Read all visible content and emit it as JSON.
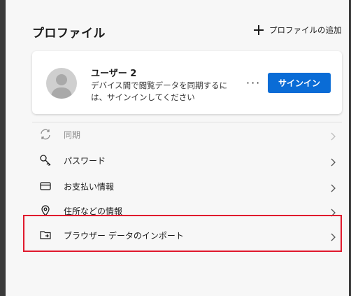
{
  "page": {
    "title": "プロファイル",
    "add_profile_label": "プロファイルの追加"
  },
  "profile_card": {
    "user_name": "ユーザー 2",
    "description": "デバイス間で閲覧データを同期するには、サインインしてください",
    "more_label": "···",
    "signin_label": "サインイン"
  },
  "menu": [
    {
      "label": "同期",
      "icon": "sync-icon",
      "disabled": true
    },
    {
      "label": "パスワード",
      "icon": "key-icon",
      "disabled": false
    },
    {
      "label": "お支払い情報",
      "icon": "credit-card-icon",
      "disabled": false
    },
    {
      "label": "住所などの情報",
      "icon": "location-pin-icon",
      "disabled": false
    },
    {
      "label": "ブラウザー データのインポート",
      "icon": "import-folder-icon",
      "disabled": false
    }
  ],
  "colors": {
    "accent": "#0a6cd6",
    "highlight": "#e0192d",
    "background": "#f7f7f7"
  }
}
